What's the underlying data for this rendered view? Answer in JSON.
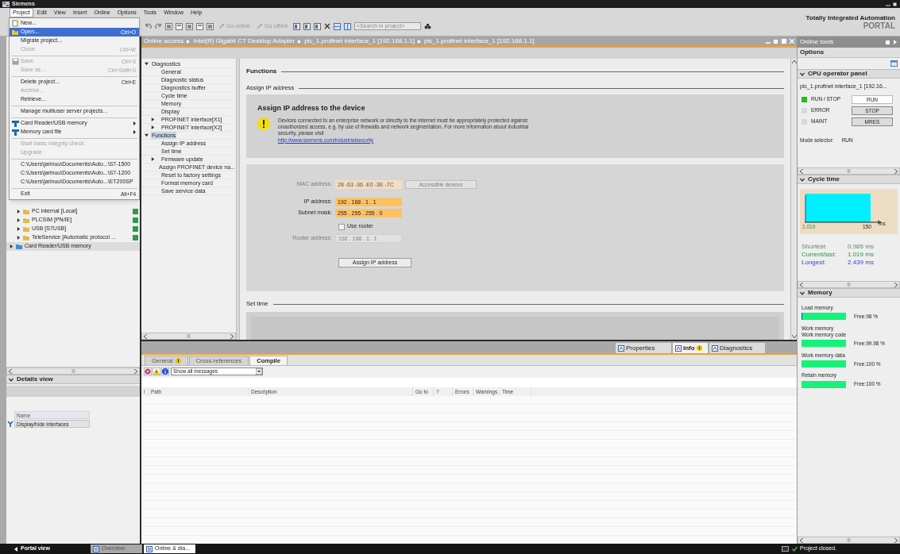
{
  "title_bar": {
    "title": "Siemens"
  },
  "menu_bar": [
    {
      "label": "Project",
      "selected": true
    },
    {
      "label": "Edit",
      "selected": false
    },
    {
      "label": "View",
      "selected": false
    },
    {
      "label": "Insert",
      "selected": false
    },
    {
      "label": "Online",
      "selected": false
    },
    {
      "label": "Options",
      "selected": false
    },
    {
      "label": "Tools",
      "selected": false
    },
    {
      "label": "Window",
      "selected": false
    },
    {
      "label": "Help",
      "selected": false
    }
  ],
  "brand": {
    "line1": "Totally Integrated Automation",
    "line2": "PORTAL"
  },
  "toolbar": {
    "go_online": "Go online",
    "go_offline": "Go offline",
    "search": {
      "placeholder": "<Search in project>"
    }
  },
  "project_menu": [
    {
      "kind": "new",
      "label": "New...",
      "selected": false,
      "disabled": false
    },
    {
      "kind": "open",
      "label": "Open...",
      "shortcut": "Ctrl+O",
      "selected": true,
      "disabled": false
    },
    {
      "kind": "item",
      "label": "Migrate project...",
      "selected": false,
      "disabled": false
    },
    {
      "kind": "item",
      "label": "Close",
      "shortcut": "Ctrl+W",
      "selected": false,
      "disabled": true
    },
    {
      "kind": "separator"
    },
    {
      "kind": "save",
      "label": "Save",
      "shortcut": "Ctrl+S",
      "selected": false,
      "disabled": true
    },
    {
      "kind": "item",
      "label": "Save as...",
      "shortcut": "Ctrl+Shift+S",
      "selected": false,
      "disabled": true
    },
    {
      "kind": "separator"
    },
    {
      "kind": "item",
      "label": "Delete project...",
      "shortcut": "Ctrl+E",
      "selected": false,
      "disabled": false
    },
    {
      "kind": "item",
      "label": "Archive...",
      "selected": false,
      "disabled": true
    },
    {
      "kind": "item",
      "label": "Retrieve...",
      "selected": false,
      "disabled": false
    },
    {
      "kind": "separator"
    },
    {
      "kind": "item",
      "label": "Manage multiuser server projects...",
      "selected": false,
      "disabled": false
    },
    {
      "kind": "separator"
    },
    {
      "kind": "card",
      "label": "Card Reader/USB memory",
      "selected": false,
      "disabled": false
    },
    {
      "kind": "card",
      "label": "Memory card file",
      "selected": false,
      "disabled": false
    },
    {
      "kind": "separator"
    },
    {
      "kind": "item",
      "label": "Start basic integrity check",
      "selected": false,
      "disabled": true
    },
    {
      "kind": "item",
      "label": "Upgrade",
      "selected": false,
      "disabled": true
    },
    {
      "kind": "separator"
    },
    {
      "kind": "item",
      "label": "C:\\Users\\jarinuu\\Documents\\Auto...\\S7-1500",
      "selected": false,
      "disabled": false
    },
    {
      "kind": "item",
      "label": "C:\\Users\\jarinuu\\Documents\\Auto...\\S7-1200",
      "selected": false,
      "disabled": false
    },
    {
      "kind": "item",
      "label": "C:\\Users\\jarinuu\\Documents\\Auto...\\ET200SP",
      "selected": false,
      "disabled": false
    },
    {
      "kind": "separator"
    },
    {
      "kind": "item",
      "label": "Exit",
      "shortcut": "Alt+F4",
      "selected": false,
      "disabled": false
    }
  ],
  "project_tree": [
    {
      "children": [
        {
          "label": "PC internal [Local]",
          "expanded": false,
          "selected": false
        },
        {
          "label": "PLCSIM [PN/IE]",
          "expanded": false,
          "selected": false
        },
        {
          "label": "USB [S7USB]",
          "expanded": false,
          "selected": false
        },
        {
          "label": "TeleService [Automatic protocol ...",
          "expanded": false,
          "selected": false
        }
      ]
    },
    {
      "label": "Card Reader/USB memory",
      "expanded": false,
      "selected": true
    }
  ],
  "details_view": {
    "title": "Details view",
    "column": "Name",
    "rows": [
      "Display/hide interfaces"
    ]
  },
  "breadcrumb": [
    "Online access",
    "Intel(R) Gigabit CT Desktop Adapter",
    "plc_1.profinet interface_1 [192.168.1.1]",
    "plc_1.profinet interface_1 [192.168.1.1]"
  ],
  "nav_tree": [
    {
      "label": "Diagnostics",
      "expanded": true,
      "selected": false,
      "children": [
        {
          "label": "General",
          "selected": false
        },
        {
          "label": "Diagnostic status",
          "selected": false
        },
        {
          "label": "Diagnostics buffer",
          "selected": false
        },
        {
          "label": "Cycle time",
          "selected": false
        },
        {
          "label": "Memory",
          "selected": false
        },
        {
          "label": "Display",
          "selected": false
        },
        {
          "label": "PROFINET interface[X1]",
          "expanded": false,
          "selected": false
        },
        {
          "label": "PROFINET interface[X2]",
          "expanded": false,
          "selected": false
        }
      ]
    },
    {
      "label": "Functions",
      "expanded": true,
      "selected": true,
      "children": [
        {
          "label": "Assign IP address",
          "selected": false
        },
        {
          "label": "Set time",
          "selected": false
        },
        {
          "label": "Firmware update",
          "expanded": false,
          "selected": false
        },
        {
          "label": "Assign PROFINET device na...",
          "selected": false
        },
        {
          "label": "Reset to factory settings",
          "selected": false
        },
        {
          "label": "Format memory card",
          "selected": false
        },
        {
          "label": "Save service data",
          "selected": false
        }
      ]
    }
  ],
  "content": {
    "heading": "Functions",
    "section": "Assign IP address",
    "info": {
      "title": "Assign IP address to the device",
      "text": "Devices connected to an enterprise network or directly to the internet must be appropriately protected against unauthorized access, e.g. by use of firewalls and network segmentation. For more information about industrial security, please visit",
      "link": "http://www.siemens.com/industrialsecurity"
    },
    "form": {
      "mac": {
        "label": "MAC address:",
        "value": "28 -63 -36 -E0 -3E -7C",
        "disabled": true
      },
      "accessible_button": {
        "label": "Accessible devices",
        "disabled": true
      },
      "ip": {
        "label": "IP address:",
        "value": "192 . 168 . 1 . 1",
        "disabled": false
      },
      "subnet": {
        "label": "Subnet mask:",
        "value": "255 . 255 . 255 . 0",
        "disabled": false
      },
      "use_router": {
        "label": "Use router",
        "checked": false
      },
      "router": {
        "label": "Router address:",
        "value": "192 . 168 . 1 . 1",
        "disabled": true
      },
      "assign_button": "Assign IP address"
    },
    "next_section": "Set time"
  },
  "inspector": {
    "tabs": [
      {
        "label": "Properties",
        "selected": false,
        "badge": false
      },
      {
        "label": "Info",
        "selected": true,
        "badge": true
      },
      {
        "label": "Diagnostics",
        "selected": false,
        "badge": false
      }
    ],
    "subtabs": [
      {
        "label": "General",
        "selected": false,
        "badge": true
      },
      {
        "label": "Cross-references",
        "selected": false,
        "badge": false
      },
      {
        "label": "Compile",
        "selected": true,
        "badge": false
      }
    ],
    "filter": "Show all messages",
    "columns": [
      "!",
      "Path",
      "Description",
      "Go to",
      "?",
      "Errors",
      "Warnings",
      "Time"
    ]
  },
  "online_tools": {
    "title": "Online tools",
    "options": "Options",
    "cpu_panel": {
      "title": "CPU operator panel",
      "device": "plc_1.profinet interface_1 [192.16...",
      "rows": [
        {
          "led": "RUN / STOP",
          "on": true,
          "button": "RUN",
          "selected": true
        },
        {
          "led": "ERROR",
          "on": false,
          "button": "STOP",
          "selected": false
        },
        {
          "led": "MAINT",
          "on": false,
          "button": "MRES",
          "selected": false
        }
      ],
      "mode_label": "Mode selector:",
      "mode_value": "RUN"
    },
    "cycle_time": {
      "title": "Cycle time",
      "axis_start": "1.019",
      "axis_end": "150",
      "unit": "ms",
      "stats": [
        {
          "label": "Shortest:",
          "value": "0.985 ms"
        },
        {
          "label": "Current/last:",
          "value": "1.019 ms"
        },
        {
          "label": "Longest:",
          "value": "2.439 ms"
        }
      ]
    },
    "memory": {
      "title": "Memory",
      "items": [
        {
          "labels": [
            "Load memory"
          ],
          "level": 0.98,
          "free": "Free:98 %"
        },
        {
          "labels": [
            "Work memory",
            "Work memory code"
          ],
          "level": 0.9998,
          "free": "Free:99.98 %"
        },
        {
          "labels": [
            "Work memory data"
          ],
          "level": 1,
          "free": "Free:100 %"
        },
        {
          "labels": [
            "Retain memory"
          ],
          "level": 1,
          "free": "Free:100 %"
        }
      ]
    }
  },
  "taskbar": {
    "portal": "Portal view",
    "tabs": [
      {
        "label": "Overview",
        "selected": false
      },
      {
        "label": "Online & dia...",
        "selected": true
      }
    ],
    "status": "Project closed."
  }
}
